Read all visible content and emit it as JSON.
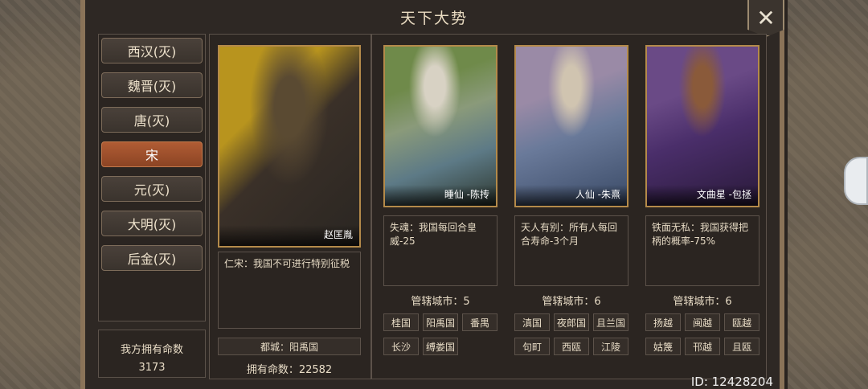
{
  "window": {
    "title": "天下大势",
    "close_label": "✕"
  },
  "dynasties": [
    {
      "label": "西汉(灭)"
    },
    {
      "label": "魏晋(灭)"
    },
    {
      "label": "唐(灭)"
    },
    {
      "label": "宋",
      "active": true
    },
    {
      "label": "元(灭)"
    },
    {
      "label": "大明(灭)"
    },
    {
      "label": "后金(灭)"
    }
  ],
  "own_lives": {
    "label": "我方拥有命数",
    "value": "3173"
  },
  "emperor": {
    "name": "赵匡胤",
    "trait": "仁宋：我国不可进行特别征税",
    "capital": "都城：阳禹国",
    "lives": "拥有命数：22582"
  },
  "cards": [
    {
      "name": "睡仙 -陈抟",
      "effect": "失魂：我国每回合皇威-25",
      "cities_label": "管辖城市：",
      "cities_count": "5",
      "cities": [
        "桂国",
        "阳禹国",
        "番禺",
        "长沙",
        "缚娄国"
      ]
    },
    {
      "name": "人仙 -朱熹",
      "effect": "天人有别：所有人每回合寿命-3个月",
      "cities_label": "管辖城市：",
      "cities_count": "6",
      "cities": [
        "滇国",
        "夜郎国",
        "且兰国",
        "句町",
        "西瓯",
        "江陵"
      ]
    },
    {
      "name": "文曲星 -包拯",
      "effect": "铁面无私：我国获得把柄的概率-75%",
      "cities_label": "管辖城市：",
      "cities_count": "6",
      "cities": [
        "扬越",
        "闽越",
        "瓯越",
        "姑篾",
        "邗越",
        "且瓯"
      ]
    }
  ],
  "footer": {
    "id_text": "ID: 12428204"
  },
  "colors": {
    "active": "#b05c34",
    "frame": "#8a7358",
    "portrait_border": "#b48a4a"
  }
}
